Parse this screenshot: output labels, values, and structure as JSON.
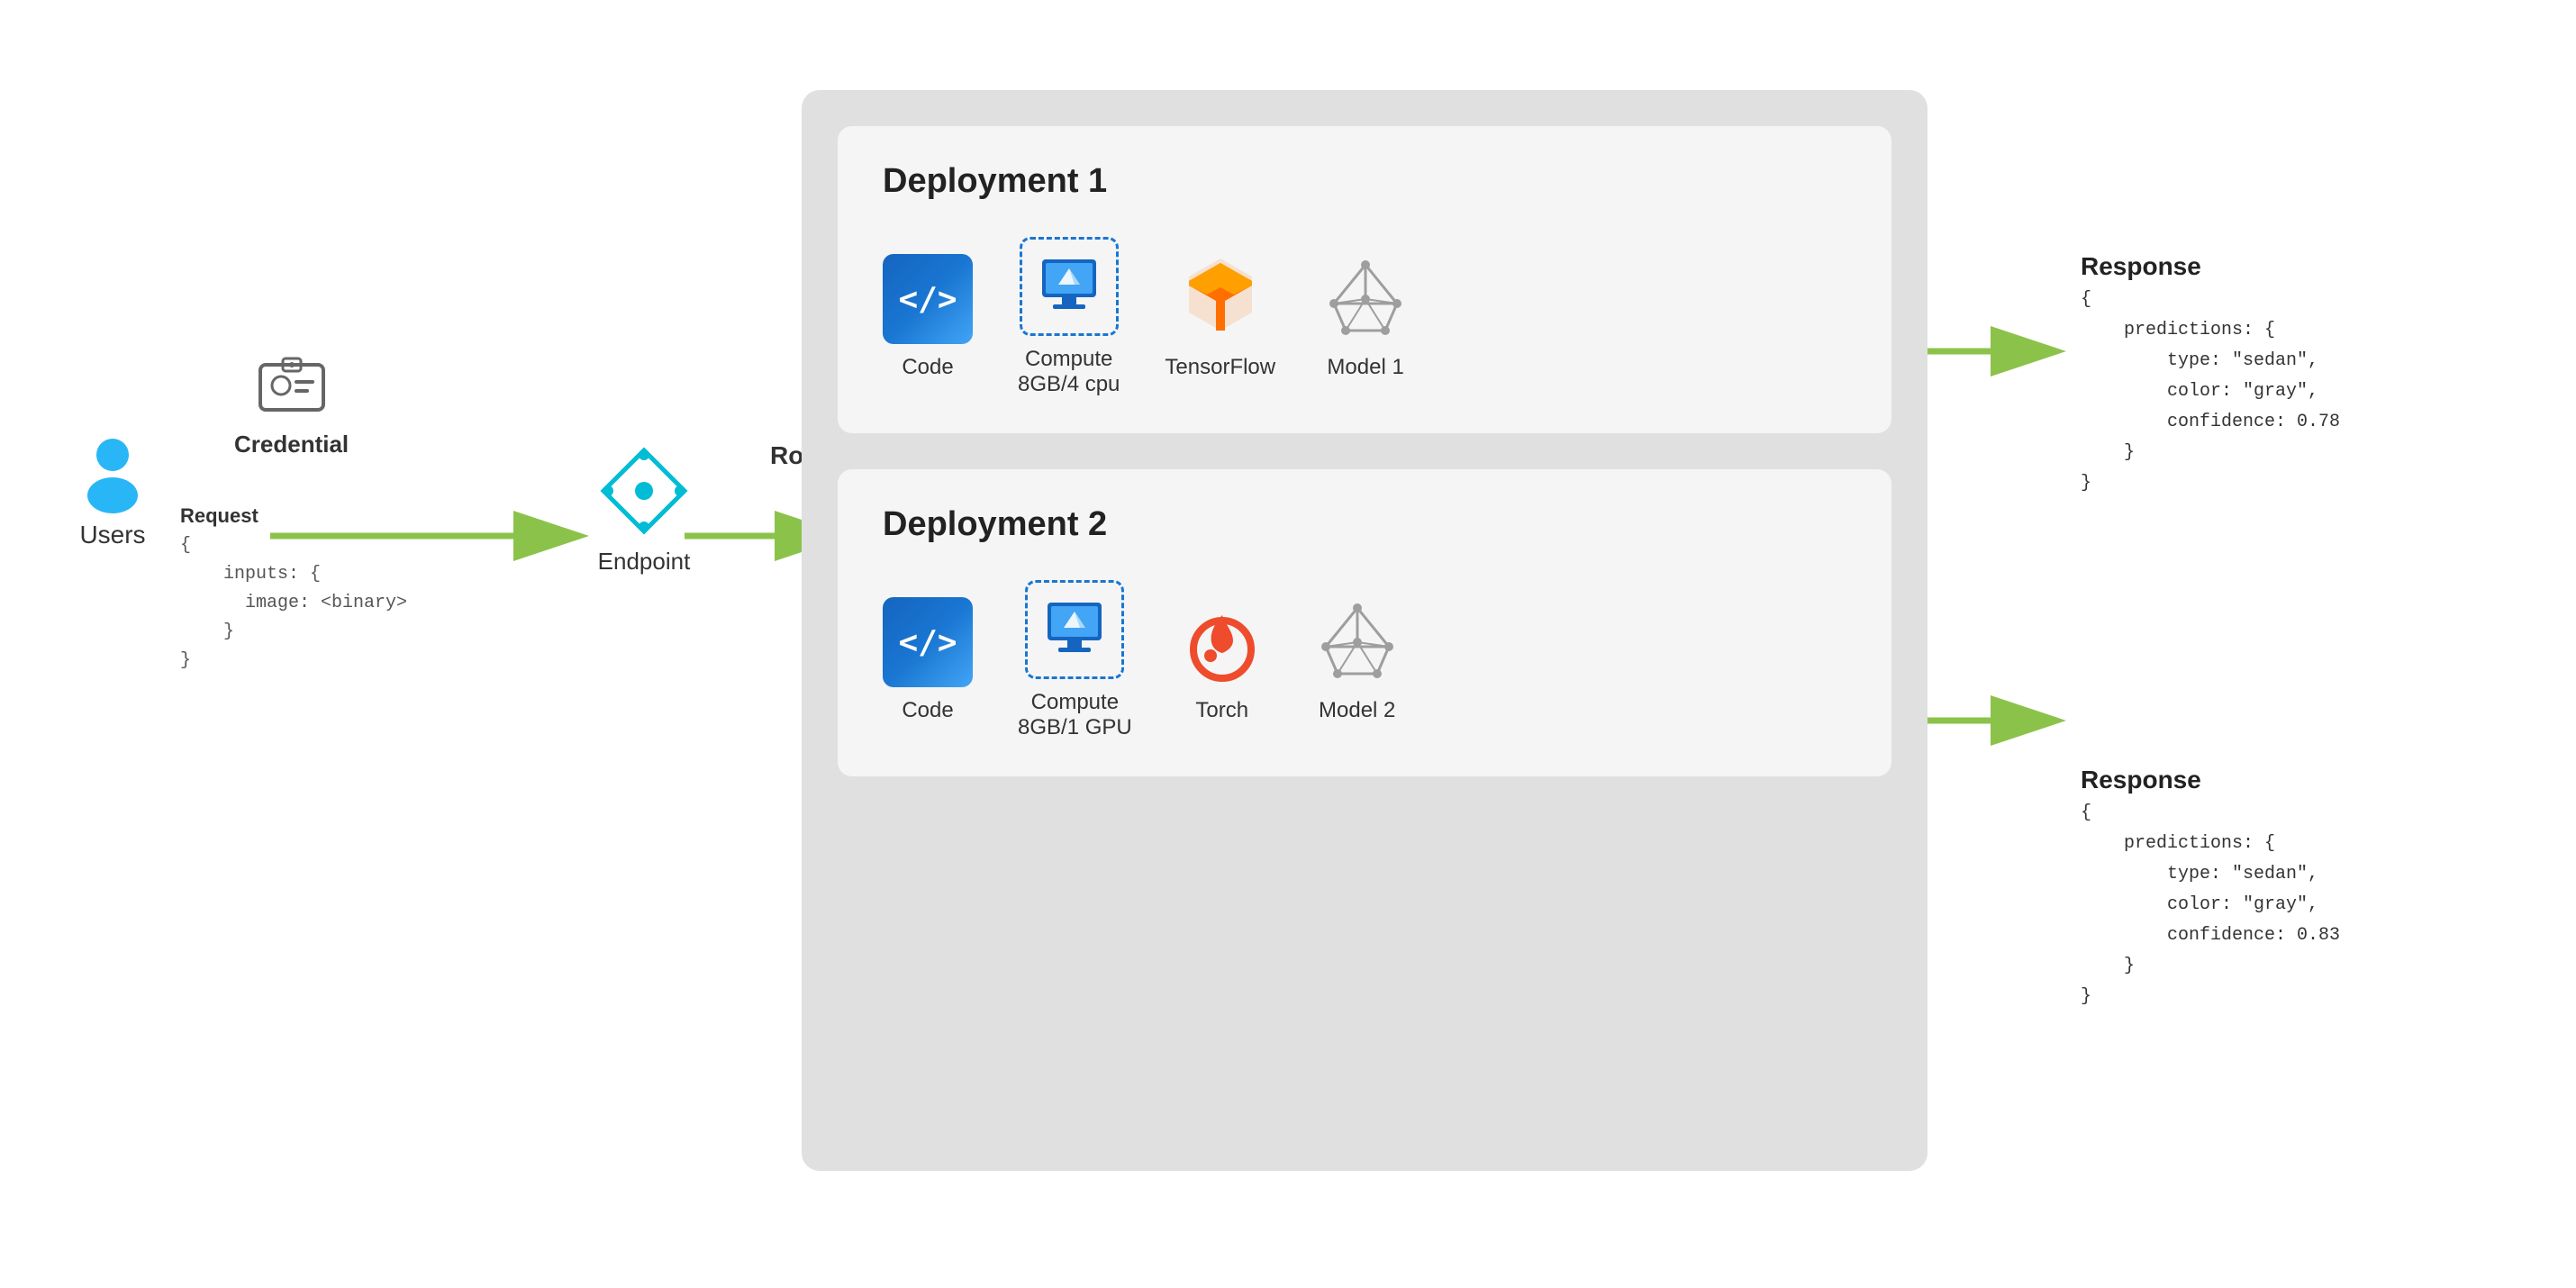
{
  "users": {
    "label": "Users",
    "icon_color": "#29b6f6"
  },
  "credential": {
    "label": "Credential"
  },
  "request": {
    "label": "Request",
    "code": "{\n    inputs: {\n      image: <binary>\n    }\n}"
  },
  "endpoint": {
    "label": "Endpoint"
  },
  "routing": {
    "label": "Routing"
  },
  "deployment1": {
    "title": "Deployment 1",
    "items": [
      {
        "label": "Code",
        "type": "code"
      },
      {
        "label": "Compute\n8GB/4 cpu",
        "type": "compute"
      },
      {
        "label": "TensorFlow",
        "type": "tensorflow"
      },
      {
        "label": "Model 1",
        "type": "model"
      }
    ],
    "response": {
      "title": "Response",
      "code": "{\n    predictions: {\n        type: \"sedan\",\n        color: \"gray\",\n        confidence: 0.78\n    }\n}"
    }
  },
  "deployment2": {
    "title": "Deployment 2",
    "items": [
      {
        "label": "Code",
        "type": "code"
      },
      {
        "label": "Compute\n8GB/1 GPU",
        "type": "compute"
      },
      {
        "label": "Torch",
        "type": "torch"
      },
      {
        "label": "Model 2",
        "type": "model"
      }
    ],
    "response": {
      "title": "Response",
      "code": "{\n    predictions: {\n        type: \"sedan\",\n        color: \"gray\",\n        confidence: 0.83\n    }\n}"
    }
  },
  "colors": {
    "arrow_green": "#8bc34a",
    "code_blue_dark": "#1565c0",
    "code_blue": "#1976d2",
    "code_blue_light": "#42a5f5",
    "tf_orange": "#f57c00",
    "torch_red": "#ee4c2c",
    "model_gray": "#9e9e9e",
    "endpoint_blue": "#00bcd4"
  }
}
